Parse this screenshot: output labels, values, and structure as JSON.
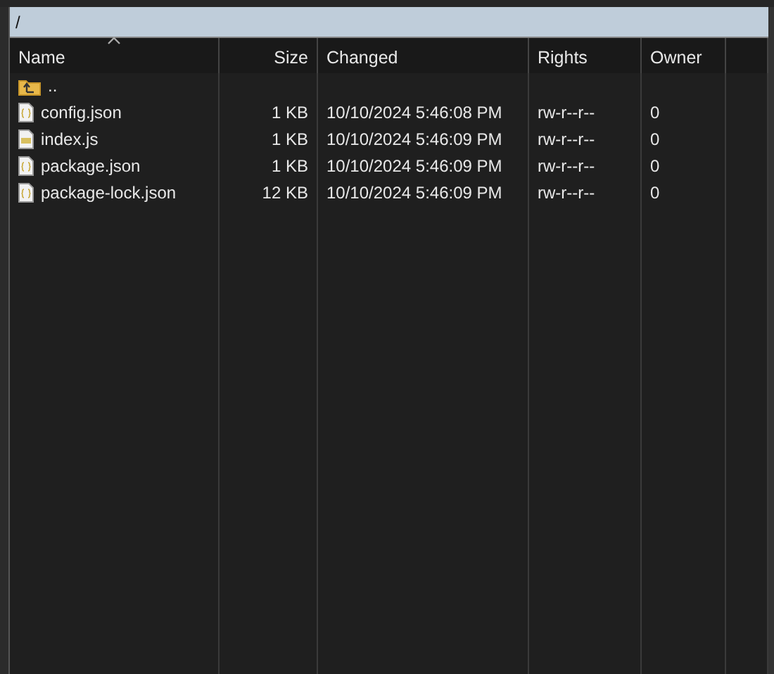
{
  "path": "/",
  "columns": [
    {
      "label": "Name",
      "sorted": true
    },
    {
      "label": "Size",
      "sorted": false
    },
    {
      "label": "Changed",
      "sorted": false
    },
    {
      "label": "Rights",
      "sorted": false
    },
    {
      "label": "Owner",
      "sorted": false
    }
  ],
  "rows": [
    {
      "kind": "up",
      "name": ".."
    },
    {
      "kind": "json",
      "name": "config.json",
      "size": "1 KB",
      "changed": "10/10/2024 5:46:08 PM",
      "rights": "rw-r--r--",
      "owner": "0"
    },
    {
      "kind": "js",
      "name": "index.js",
      "size": "1 KB",
      "changed": "10/10/2024 5:46:09 PM",
      "rights": "rw-r--r--",
      "owner": "0"
    },
    {
      "kind": "json",
      "name": "package.json",
      "size": "1 KB",
      "changed": "10/10/2024 5:46:09 PM",
      "rights": "rw-r--r--",
      "owner": "0"
    },
    {
      "kind": "json",
      "name": "package-lock.json",
      "size": "12 KB",
      "changed": "10/10/2024 5:46:09 PM",
      "rights": "rw-r--r--",
      "owner": "0"
    }
  ]
}
